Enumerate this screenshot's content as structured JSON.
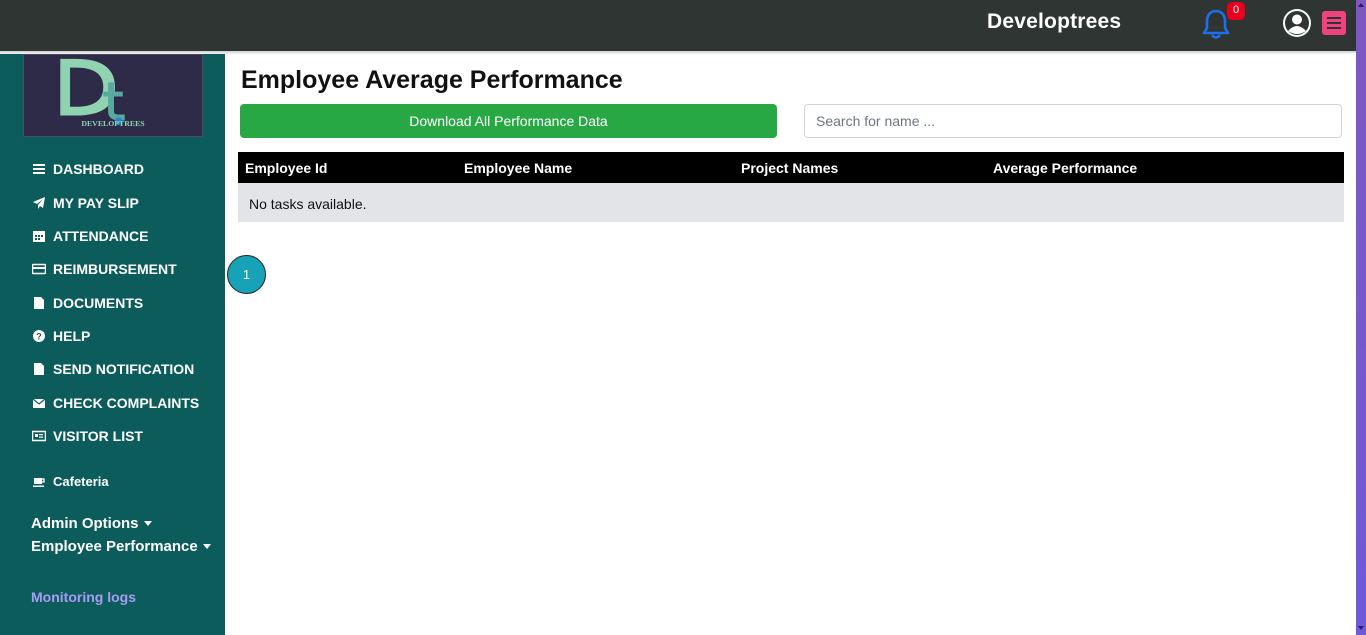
{
  "header": {
    "brand": "Developtrees",
    "notification_count": "0"
  },
  "sidebar": {
    "logo_text": "DEVELOPTREES",
    "items": [
      {
        "label": "DASHBOARD",
        "icon": "bars-icon"
      },
      {
        "label": "MY PAY SLIP",
        "icon": "paper-plane-icon"
      },
      {
        "label": "ATTENDANCE",
        "icon": "calendar-icon"
      },
      {
        "label": "REIMBURSEMENT",
        "icon": "credit-card-icon"
      },
      {
        "label": "DOCUMENTS",
        "icon": "file-icon"
      },
      {
        "label": "HELP",
        "icon": "question-circle-icon"
      },
      {
        "label": "SEND NOTIFICATION",
        "icon": "file-icon"
      },
      {
        "label": "CHECK COMPLAINTS",
        "icon": "envelope-icon"
      },
      {
        "label": "VISITOR LIST",
        "icon": "id-card-icon"
      },
      {
        "label": "Cafeteria",
        "icon": "coffee-icon"
      }
    ],
    "admin_options": "Admin Options",
    "employee_performance": "Employee Performance",
    "monitoring_logs": "Monitoring logs"
  },
  "main": {
    "title": "Employee Average Performance",
    "download_label": "Download All Performance Data",
    "search_placeholder": "Search for name ...",
    "columns": [
      "Employee Id",
      "Employee Name",
      "Project Names",
      "Average Performance"
    ],
    "empty_message": "No tasks available.",
    "current_page": "1"
  },
  "colors": {
    "topbar": "#2f3532",
    "sidebar": "#0d5c5c",
    "download_button": "#28a745",
    "pagination": "#17a2b8",
    "badge": "#e8001c",
    "menu_button": "#f0427f"
  }
}
